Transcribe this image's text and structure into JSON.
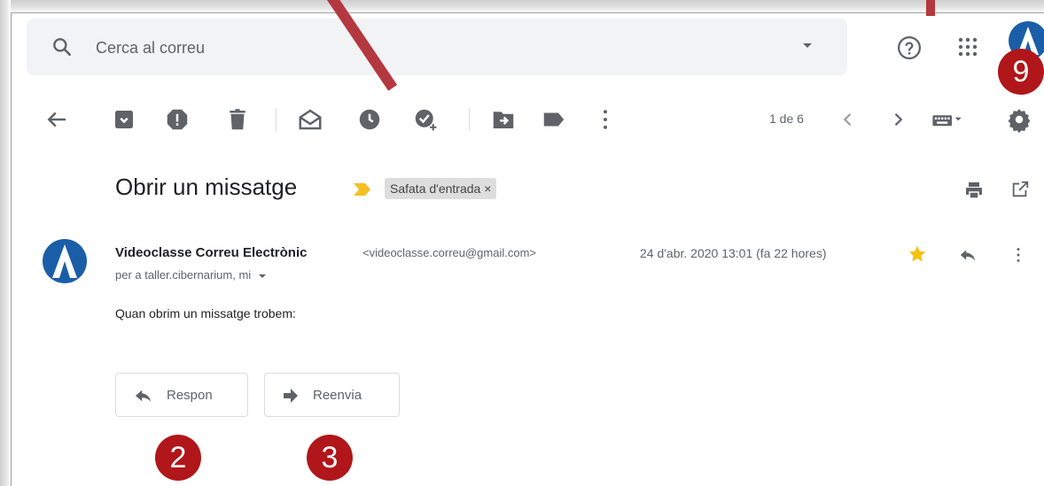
{
  "search": {
    "placeholder": "Cerca al correu"
  },
  "toolbar": {
    "pager": "1 de 6"
  },
  "message": {
    "subject": "Obrir un missatge",
    "label": "Safata d'entrada ×",
    "sender_name": "Videoclasse Correu Electrònic",
    "sender_email": "<videoclasse.correu@gmail.com>",
    "recipients": "per a taller.cibernarium, mi",
    "date": "24 d'abr. 2020 13:01 (fa 22 hores)",
    "body": "Quan obrim un missatge trobem:"
  },
  "actions": {
    "reply": "Respon",
    "forward": "Reenvia"
  },
  "annotations": {
    "badge_9": "9",
    "badge_2": "2",
    "badge_3": "3"
  },
  "colors": {
    "badge": "#b0161a",
    "arrow": "#b4383f",
    "star": "#f4c20d",
    "important_marker": "#f6bf26",
    "avatar": "#1b5ea8"
  },
  "icons": {
    "top": [
      "help-icon",
      "apps-icon",
      "account-avatar"
    ],
    "toolbar": [
      "back-arrow-icon",
      "archive-icon",
      "report-spam-icon",
      "delete-icon",
      "mark-unread-icon",
      "snooze-icon",
      "add-to-tasks-icon",
      "move-to-icon",
      "labels-icon",
      "more-icon",
      "prev-icon",
      "next-icon",
      "input-tools-icon",
      "settings-icon"
    ],
    "message": [
      "print-icon",
      "open-new-window-icon",
      "star-icon",
      "reply-icon",
      "more-vert-icon"
    ]
  }
}
